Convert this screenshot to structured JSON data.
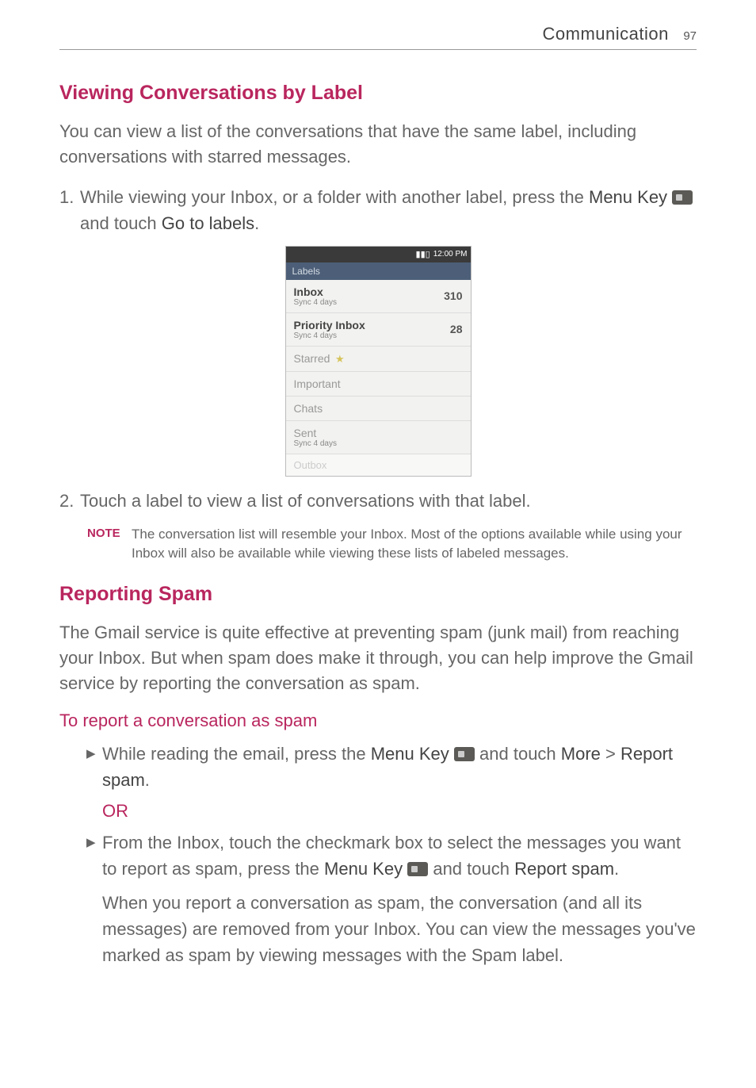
{
  "header": {
    "title": "Communication",
    "page_number": "97"
  },
  "section1": {
    "heading": "Viewing Conversations by Label",
    "intro": "You can view a list of the conversations that have the same label, including conversations with starred messages.",
    "step1_num": "1.",
    "step1_a": "While viewing your Inbox, or a folder with another label, press the ",
    "step1_b": "Menu Key",
    "step1_c": " and touch ",
    "step1_d": "Go to labels",
    "step1_e": ".",
    "step2_num": "2.",
    "step2_text": "Touch a label to view a list of conversations with that label.",
    "note_label": "NOTE",
    "note_text": "The conversation list will resemble your Inbox. Most of the options available while using your Inbox will also be available while viewing these lists of labeled messages."
  },
  "phone_screenshot": {
    "time": "12:00 PM",
    "header": "Labels",
    "rows": [
      {
        "name": "Inbox",
        "sub": "Sync 4 days",
        "count": "310",
        "bold": true
      },
      {
        "name": "Priority Inbox",
        "sub": "Sync 4 days",
        "count": "28",
        "bold": true
      },
      {
        "name": "Starred",
        "star": true
      },
      {
        "name": "Important"
      },
      {
        "name": "Chats"
      },
      {
        "name": "Sent",
        "sub": "Sync 4 days"
      }
    ],
    "outbox": "Outbox"
  },
  "section2": {
    "heading": "Reporting Spam",
    "intro": "The Gmail service is quite effective at preventing spam (junk mail) from reaching your Inbox. But when spam does make it through, you can help improve the Gmail service by reporting the conversation as spam.",
    "sub_heading": "To report a conversation as spam",
    "bullet1_a": "While reading the email, press the ",
    "bullet1_b": "Menu Key",
    "bullet1_c": " and touch ",
    "bullet1_d": "More",
    "bullet1_e": " > ",
    "bullet1_f": "Report spam",
    "bullet1_g": ".",
    "or": "OR",
    "bullet2_a": "From the Inbox, touch the checkmark box to select the messages you want to report as spam, press the ",
    "bullet2_b": "Menu Key",
    "bullet2_c": " and touch ",
    "bullet2_d": "Report spam",
    "bullet2_e": ".",
    "followup": "When you report a conversation as spam, the conversation (and all its messages) are removed from your Inbox. You can view the messages you've marked as spam by viewing messages with the Spam label."
  }
}
